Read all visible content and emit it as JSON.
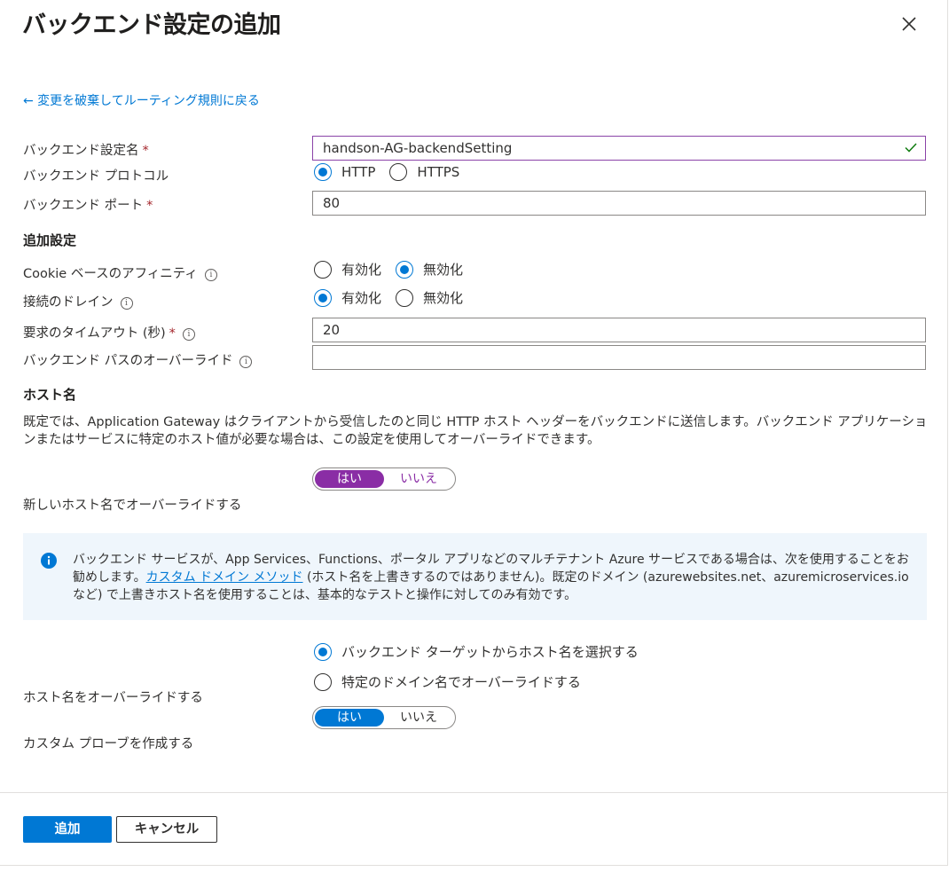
{
  "title": "バックエンド設定の追加",
  "back_link": "← 変更を破棄してルーティング規則に戻る",
  "fields": {
    "setting_name": {
      "label": "バックエンド設定名",
      "required": "*",
      "value": "handson-AG-backendSetting"
    },
    "protocol": {
      "label": "バックエンド プロトコル",
      "options": [
        "HTTP",
        "HTTPS"
      ],
      "selected": "HTTP"
    },
    "port": {
      "label": "バックエンド ポート",
      "required": "*",
      "value": "80"
    }
  },
  "additional": {
    "heading": "追加設定",
    "cookie_affinity": {
      "label": "Cookie ベースのアフィニティ",
      "options": [
        "有効化",
        "無効化"
      ],
      "selected": "無効化"
    },
    "connection_drain": {
      "label": "接続のドレイン",
      "options": [
        "有効化",
        "無効化"
      ],
      "selected": "有効化"
    },
    "timeout": {
      "label": "要求のタイムアウト (秒)",
      "required": "*",
      "value": "20"
    },
    "path_override": {
      "label": "バックエンド パスのオーバーライド",
      "value": ""
    }
  },
  "hostname": {
    "heading": "ホスト名",
    "description": "既定では、Application Gateway はクライアントから受信したのと同じ HTTP ホスト ヘッダーをバックエンドに送信します。バックエンド アプリケーションまたはサービスに特定のホスト値が必要な場合は、この設定を使用してオーバーライドできます。",
    "override_new_label": "新しいホスト名でオーバーライドする",
    "override_new_toggle": {
      "yes": "はい",
      "no": "いいえ",
      "selected": "はい"
    },
    "info": {
      "text_before": "バックエンド サービスが、App Services、Functions、ポータル アプリなどのマルチテナント Azure サービスである場合は、次を使用することをお勧めします。",
      "link": "カスタム ドメイン メソッド",
      "text_after": " (ホスト名を上書きするのではありません)。既定のドメイン (azurewebsites.net、azuremicroservices.io など) で上書きホスト名を使用することは、基本的なテストと操作に対してのみ有効です。"
    },
    "override_label": "ホスト名をオーバーライドする",
    "override_options": [
      "バックエンド ターゲットからホスト名を選択する",
      "特定のドメイン名でオーバーライドする"
    ],
    "override_selected": "バックエンド ターゲットからホスト名を選択する",
    "probe_label": "カスタム プローブを作成する",
    "probe_toggle": {
      "yes": "はい",
      "no": "いいえ",
      "selected": "はい"
    }
  },
  "buttons": {
    "add": "追加",
    "cancel": "キャンセル"
  },
  "colors": {
    "accent": "#0078d4",
    "toggle_purple": "#8a2da5",
    "required": "#a4262c",
    "valid_check": "#107c10"
  }
}
